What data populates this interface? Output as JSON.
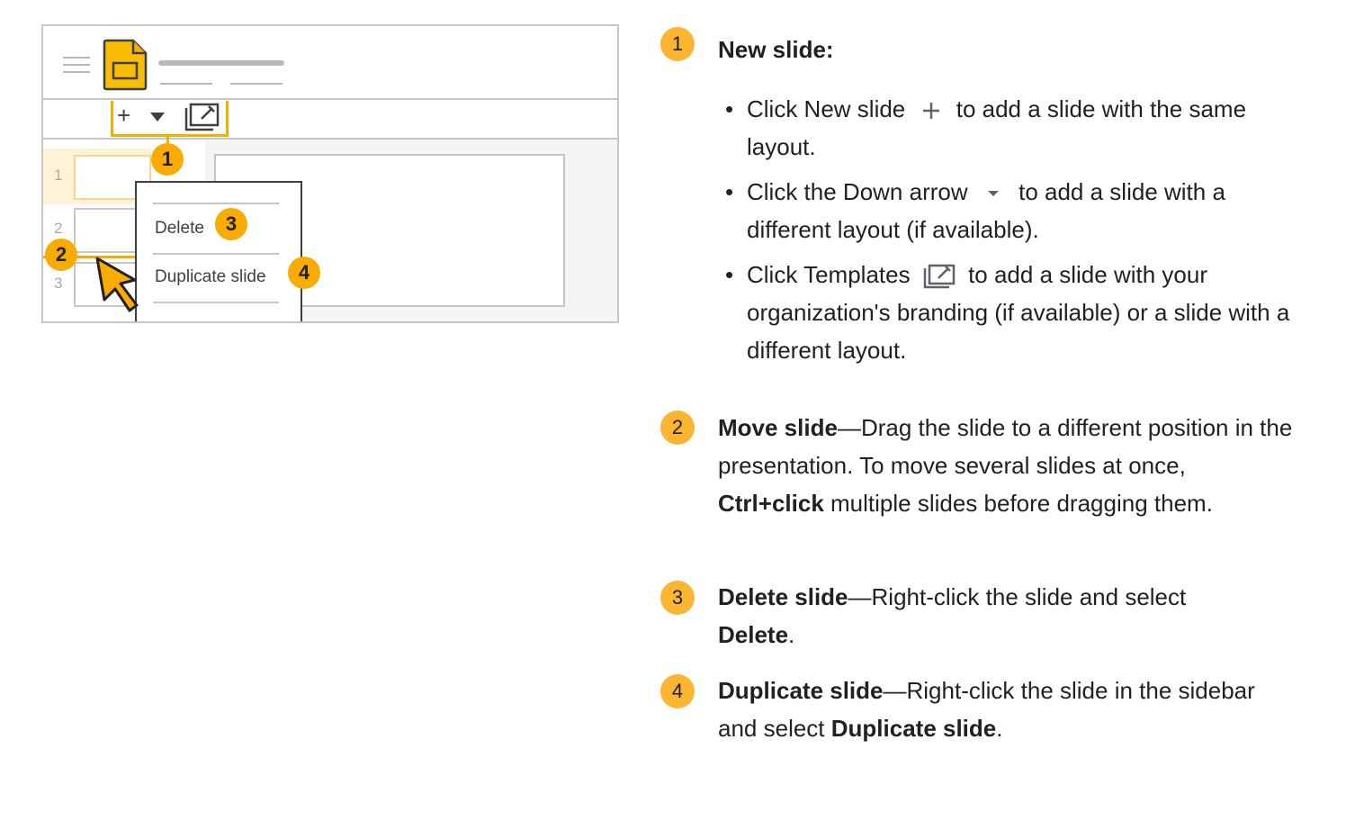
{
  "illustration": {
    "slide_numbers": [
      "1",
      "2",
      "3"
    ],
    "context_menu": {
      "delete": "Delete",
      "duplicate": "Duplicate slide"
    },
    "badges": [
      "1",
      "2",
      "3",
      "4"
    ],
    "colors": {
      "accent": "#f9ab00",
      "highlight": "#fef3d9",
      "border": "#c4c7c5"
    },
    "icons": [
      "hamburger-menu-icon",
      "slides-file-icon",
      "plus-icon",
      "down-arrow-icon",
      "templates-icon",
      "mouse-cursor-icon"
    ]
  },
  "steps": [
    {
      "num": "1",
      "title": "New slide:",
      "bullets": [
        {
          "a": "Click New slide",
          "b": "to add a slide with the same layout."
        },
        {
          "a": "Click the Down arrow",
          "b": "to add a slide with a different layout (if available)."
        },
        {
          "a": "Click Templates",
          "b": "to add a slide with your organization's branding (if available) or a slide with a different layout."
        }
      ]
    },
    {
      "num": "2",
      "title": "Move slide",
      "text": "—Drag the slide to a different position in the presentation. To move several slides at once, ",
      "bold2": "Ctrl+click",
      "text2": " multiple slides before dragging them."
    },
    {
      "num": "3",
      "title": "Delete slide",
      "text": "—Right-click the slide and select ",
      "bold2": "Delete",
      "text2": "."
    },
    {
      "num": "4",
      "title": "Duplicate slide",
      "text": "—Right-click the slide in the sidebar and select ",
      "bold2": "Duplicate slide",
      "text2": "."
    }
  ]
}
